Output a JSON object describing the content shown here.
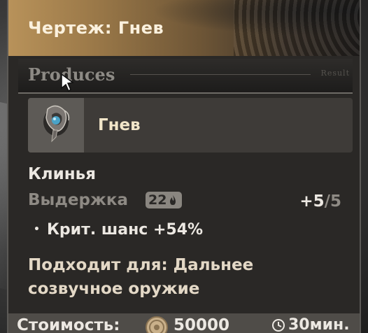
{
  "tooltip": {
    "title": "Чертеж: Гнев",
    "section": {
      "label": "Produces",
      "right_label": "Result"
    },
    "product": {
      "name": "Гнев",
      "icon": "tuning-module-icon"
    },
    "weapon_type": "Клинья",
    "durability": {
      "label": "Выдержка",
      "value": "22",
      "icon": "flame-icon"
    },
    "refinement": {
      "current": "+5",
      "max": "/5"
    },
    "stat": {
      "bullet": "•",
      "text": "Крит. шанс +54%"
    },
    "suitable_for": "Подходит для: Дальнее созвучное оружие",
    "cost": {
      "label": "Стоимость:",
      "value": "50000",
      "icon": "coin-icon"
    },
    "time": {
      "value": "30мин.",
      "icon": "clock-icon"
    }
  },
  "colors": {
    "header_gold": "#b8925a",
    "panel_bg": "#2a2826",
    "title_text": "#fbf1de",
    "muted_text": "#8e8a84"
  }
}
